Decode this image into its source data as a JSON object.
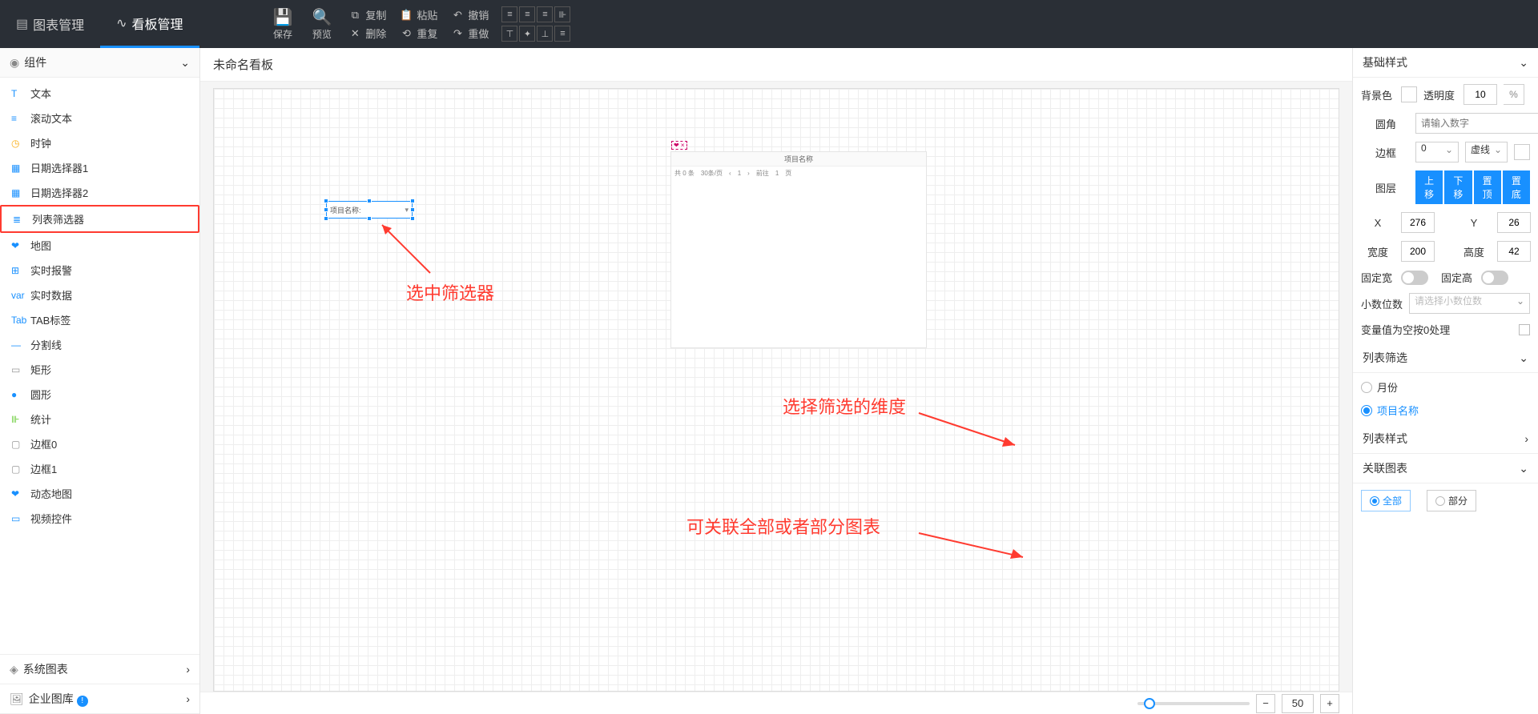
{
  "topbar": {
    "tabs": [
      {
        "label": "图表管理",
        "icon": "▤"
      },
      {
        "label": "看板管理",
        "icon": "∿"
      }
    ],
    "big_buttons": [
      {
        "label": "保存",
        "icon": "💾"
      },
      {
        "label": "预览",
        "icon": "🔍"
      }
    ],
    "mini_cols": [
      [
        {
          "label": "复制",
          "icon": "⧉"
        },
        {
          "label": "删除",
          "icon": "✕"
        }
      ],
      [
        {
          "label": "粘贴",
          "icon": "📋"
        },
        {
          "label": "重复",
          "icon": "⟲"
        }
      ],
      [
        {
          "label": "撤销",
          "icon": "↶"
        },
        {
          "label": "重做",
          "icon": "↷"
        }
      ]
    ]
  },
  "left": {
    "header": "组件",
    "items": [
      {
        "label": "文本",
        "icon": "T",
        "color": "#1890ff"
      },
      {
        "label": "滚动文本",
        "icon": "≡",
        "color": "#1890ff"
      },
      {
        "label": "时钟",
        "icon": "◷",
        "color": "#faad14"
      },
      {
        "label": "日期选择器1",
        "icon": "▦",
        "color": "#1890ff"
      },
      {
        "label": "日期选择器2",
        "icon": "▦",
        "color": "#1890ff"
      },
      {
        "label": "列表筛选器",
        "icon": "≣",
        "color": "#1890ff",
        "highlight": true
      },
      {
        "label": "地图",
        "icon": "❤",
        "color": "#1890ff"
      },
      {
        "label": "实时报警",
        "icon": "⊞",
        "color": "#1890ff"
      },
      {
        "label": "实时数据",
        "icon": "var",
        "color": "#1890ff"
      },
      {
        "label": "TAB标签",
        "icon": "Tab",
        "color": "#1890ff"
      },
      {
        "label": "分割线",
        "icon": "—",
        "color": "#1890ff"
      },
      {
        "label": "矩形",
        "icon": "▭",
        "color": "#999"
      },
      {
        "label": "圆形",
        "icon": "●",
        "color": "#1890ff"
      },
      {
        "label": "统计",
        "icon": "⊪",
        "color": "#52c41a"
      },
      {
        "label": "边框0",
        "icon": "▢",
        "color": "#999"
      },
      {
        "label": "边框1",
        "icon": "▢",
        "color": "#999"
      },
      {
        "label": "动态地图",
        "icon": "❤",
        "color": "#1890ff"
      },
      {
        "label": "视频控件",
        "icon": "▭",
        "color": "#1890ff"
      }
    ],
    "footers": [
      {
        "label": "系统图表",
        "icon": "◈"
      },
      {
        "label": "企业图库",
        "icon": "🖼",
        "badge": "!"
      }
    ]
  },
  "canvas": {
    "title": "未命名看板",
    "filter_label": "项目名称:",
    "table": {
      "tag": "❤ ×",
      "header": "项目名称",
      "total": "共 0 条",
      "pagesize": "30条/页",
      "goto": "前往",
      "page": "1",
      "page_suffix": "页"
    },
    "zoom": {
      "val": "50"
    },
    "anno1": "选中筛选器",
    "anno2": "选择筛选的维度",
    "anno3": "可关联全部或者部分图表"
  },
  "right": {
    "sec_basic": "基础样式",
    "bg": "背景色",
    "opacity": "透明度",
    "opacity_val": "10",
    "opacity_unit": "%",
    "radius": "圆角",
    "radius_ph": "请输入数字",
    "border": "边框",
    "border_w": "0",
    "border_style": "虚线",
    "layer": "图层",
    "layer_btns": [
      "上移",
      "下移",
      "置顶",
      "置底"
    ],
    "x": "X",
    "x_val": "276",
    "y": "Y",
    "y_val": "26",
    "w": "宽度",
    "w_val": "200",
    "h": "高度",
    "h_val": "42",
    "lock_w": "固定宽",
    "lock_h": "固定高",
    "decimals": "小数位数",
    "decimals_ph": "请选择小数位数",
    "zero": "变量值为空按0处理",
    "sec_filter": "列表筛选",
    "filter_opts": [
      {
        "label": "月份",
        "on": false
      },
      {
        "label": "项目名称",
        "on": true
      }
    ],
    "sec_style": "列表样式",
    "sec_link": "关联图表",
    "link_opts": [
      {
        "label": "全部",
        "on": true
      },
      {
        "label": "部分",
        "on": false
      }
    ]
  }
}
